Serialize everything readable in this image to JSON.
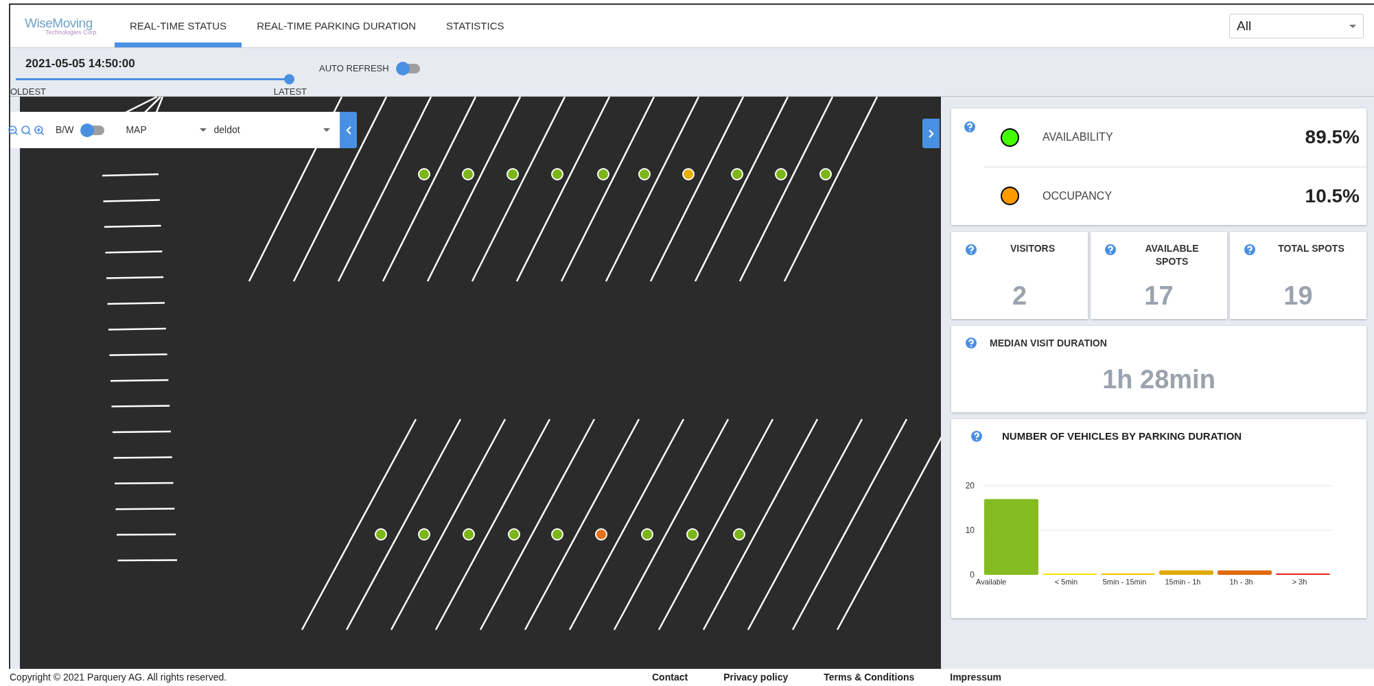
{
  "header": {
    "logo": "WiseMoving",
    "logo_sub": "Technologies Corp",
    "tabs": [
      {
        "label": "REAL-TIME STATUS",
        "selected": true
      },
      {
        "label": "REAL-TIME PARKING DURATION",
        "selected": false
      },
      {
        "label": "STATISTICS",
        "selected": false
      }
    ],
    "filter": {
      "value": "All"
    }
  },
  "toolbar": {
    "timestamp": "2021-05-05 14:50:00",
    "slider": {
      "level": 0.985,
      "min_label": "OLDEST",
      "max_label": "LATEST"
    },
    "auto_refresh": {
      "label": "AUTO REFRESH",
      "on": false
    }
  },
  "map_controls": {
    "bw": {
      "label": "B/W",
      "on": false
    },
    "layer": {
      "value": "MAP"
    },
    "source": {
      "value": "deldot"
    }
  },
  "map": {
    "top_row_spots": [
      {
        "color": "#7cb518"
      },
      {
        "color": "#7cb518"
      },
      {
        "color": "#7cb518"
      },
      {
        "color": "#7cb518"
      },
      {
        "color": "#7cb518"
      },
      {
        "color": "#7cb518"
      },
      {
        "color": "#e8b000"
      },
      {
        "color": "#7cb518"
      },
      {
        "color": "#7cb518"
      },
      {
        "color": "#7cb518"
      }
    ],
    "bottom_row_spots": [
      {
        "color": "#7cb518"
      },
      {
        "color": "#7cb518"
      },
      {
        "color": "#7cb518"
      },
      {
        "color": "#7cb518"
      },
      {
        "color": "#7cb518"
      },
      {
        "color": "#e8701a"
      },
      {
        "color": "#7cb518"
      },
      {
        "color": "#7cb518"
      },
      {
        "color": "#7cb518"
      }
    ]
  },
  "stats": {
    "rates": [
      {
        "label": "AVAILABILITY",
        "value": "89.5%",
        "color": "#44ff00"
      },
      {
        "label": "OCCUPANCY",
        "value": "10.5%",
        "color": "#ff9900"
      }
    ],
    "cards": [
      {
        "label": "VISITORS",
        "value": "2"
      },
      {
        "label": "AVAILABLE SPOTS",
        "value": "17"
      },
      {
        "label": "TOTAL SPOTS",
        "value": "19"
      }
    ],
    "median": {
      "label": "MEDIAN VISIT DURATION",
      "value": "1h 28min"
    },
    "chart": {
      "title": "NUMBER OF VEHICLES BY PARKING DURATION",
      "chart_data": {
        "type": "bar",
        "categories": [
          "Available",
          "< 5min",
          "5min - 15min",
          "15min - 1h",
          "1h - 3h",
          "> 3h"
        ],
        "series": [
          {
            "color": "#84bc22",
            "values": [
              17,
              null,
              null,
              null,
              null,
              null
            ]
          },
          {
            "color": "#f5e600",
            "values": [
              null,
              0,
              null,
              null,
              null,
              null
            ]
          },
          {
            "color": "#f0c000",
            "values": [
              null,
              null,
              0,
              null,
              null,
              null
            ]
          },
          {
            "color": "#e0aa00",
            "values": [
              null,
              null,
              null,
              1,
              null,
              null
            ]
          },
          {
            "color": "#e06b10",
            "values": [
              null,
              null,
              null,
              null,
              1,
              null
            ]
          },
          {
            "color": "#e02020",
            "values": [
              null,
              null,
              null,
              null,
              null,
              0
            ]
          }
        ],
        "ylim": [
          0,
          20
        ],
        "yticks": [
          0,
          10,
          20
        ]
      }
    }
  },
  "footer": {
    "copyright": "Copyright © 2021 Parquery AG. All rights reserved.",
    "links": [
      "Contact",
      "Privacy policy",
      "Terms & Conditions",
      "Impressum"
    ]
  }
}
